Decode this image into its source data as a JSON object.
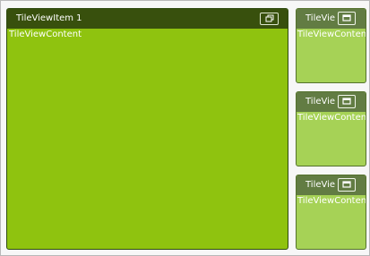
{
  "tiles": [
    {
      "title": "TileViewItem 1",
      "content": "TileViewContent",
      "state": "maximized",
      "button_icon": "restore-icon"
    },
    {
      "title": "TileVie",
      "content": "TileViewContent",
      "state": "minimized",
      "button_icon": "maximize-icon"
    },
    {
      "title": "TileVie",
      "content": "TileViewContent",
      "state": "minimized",
      "button_icon": "maximize-icon"
    },
    {
      "title": "TileVie",
      "content": "TileViewContent",
      "state": "minimized",
      "button_icon": "maximize-icon"
    }
  ],
  "colors": {
    "large_header": "#38500d",
    "large_body": "#8fc30f",
    "small_header": "#627c43",
    "small_body": "#a6d256"
  }
}
